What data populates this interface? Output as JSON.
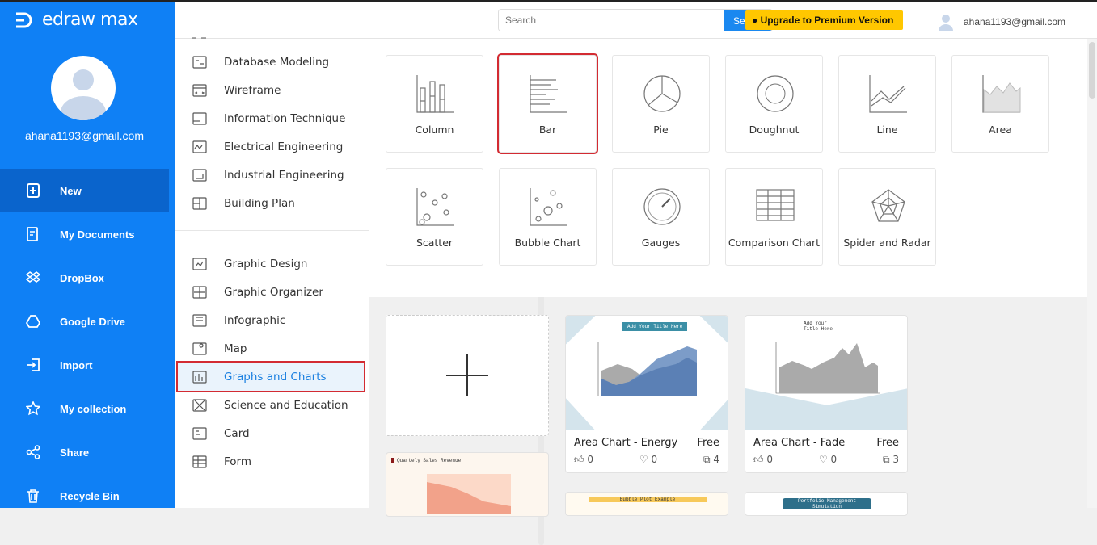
{
  "app": {
    "name": "edraw max"
  },
  "user": {
    "email": "ahana1193@gmail.com"
  },
  "sidebar": {
    "items": [
      {
        "label": "New",
        "icon": "new-file-icon",
        "active": true
      },
      {
        "label": "My Documents",
        "icon": "documents-icon"
      },
      {
        "label": "DropBox",
        "icon": "dropbox-icon"
      },
      {
        "label": "Google Drive",
        "icon": "google-drive-icon"
      },
      {
        "label": "Import",
        "icon": "import-icon"
      },
      {
        "label": "My collection",
        "icon": "star-icon"
      },
      {
        "label": "Share",
        "icon": "share-icon"
      },
      {
        "label": "Recycle Bin",
        "icon": "trash-icon"
      }
    ]
  },
  "topbar": {
    "search_placeholder": "Search",
    "search_button": "Search",
    "upgrade": "● Upgrade to Premium Version",
    "email": "ahana1193@gmail.com"
  },
  "categories": {
    "group1": [
      "Database Modeling",
      "Wireframe",
      "Information Technique",
      "Electrical Engineering",
      "Industrial Engineering",
      "Building Plan"
    ],
    "group2": [
      "Graphic Design",
      "Graphic Organizer",
      "Infographic",
      "Map",
      "Graphs and Charts",
      "Science and Education",
      "Card",
      "Form"
    ],
    "selected": "Graphs and Charts"
  },
  "chart_types": [
    "Column",
    "Bar",
    "Pie",
    "Doughnut",
    "Line",
    "Area",
    "Scatter",
    "Bubble Chart",
    "Gauges",
    "Comparison Chart",
    "Spider and Radar"
  ],
  "selected_chart_type": "Bar",
  "templates": [
    {
      "title": "Area Chart - Energy",
      "price": "Free",
      "likes": "0",
      "favorites": "0",
      "copies": "4",
      "thumb_title": "Add Your Title Here"
    },
    {
      "title": "Area Chart - Fade",
      "price": "Free",
      "likes": "0",
      "favorites": "0",
      "copies": "3",
      "thumb_title": "Add Your Title Here"
    },
    {
      "thumb_title": "Quartely Sales Revenue"
    },
    {
      "thumb_title": "Bubble Plot Example"
    },
    {
      "thumb_title": "Portfolio Management Simulation"
    }
  ],
  "colors": {
    "sidebar": "#0f80f5",
    "sidebar_active": "#0a64cc",
    "upgrade": "#ffc700",
    "highlight": "#d32b32",
    "accent": "#1a7fe0"
  }
}
